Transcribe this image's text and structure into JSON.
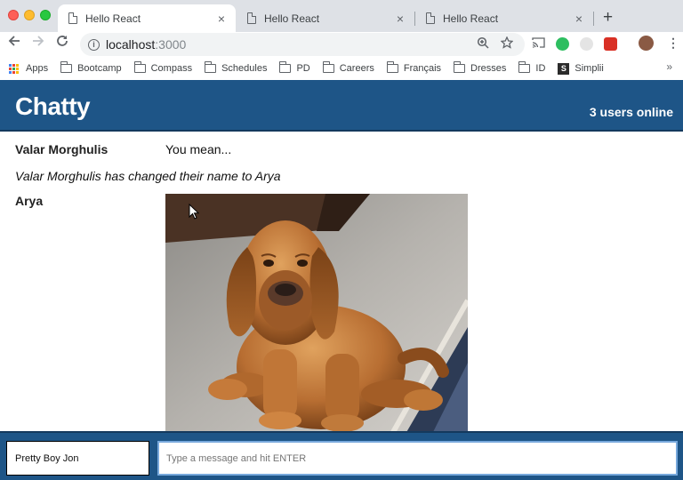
{
  "browser": {
    "tabs": [
      {
        "title": "Hello React",
        "active": true
      },
      {
        "title": "Hello React",
        "active": false
      },
      {
        "title": "Hello React",
        "active": false
      }
    ],
    "close_glyph": "×",
    "new_tab_glyph": "+",
    "url_host": "localhost",
    "url_port": ":3000",
    "bookmarks": {
      "apps": "Apps",
      "folders": [
        "Bootcamp",
        "Compass",
        "Schedules",
        "PD",
        "Careers",
        "Français",
        "Dresses",
        "ID"
      ],
      "simplii": "Simplii"
    }
  },
  "app": {
    "brand": "Chatty",
    "users_online": "3 users online",
    "messages": [
      {
        "type": "message",
        "user": "Valar Morghulis",
        "content": "You mean..."
      },
      {
        "type": "notification",
        "content": "Valar Morghulis has changed their name to Arya"
      },
      {
        "type": "image",
        "user": "Arya",
        "image_subject": "bloodhound puppy sitting on carpet"
      }
    ],
    "composer": {
      "username_value": "Pretty Boy Jon",
      "message_placeholder": "Type a message and hit ENTER"
    }
  },
  "colors": {
    "header_bg": "#1e5587",
    "input_focus_border": "#78a9dc"
  }
}
